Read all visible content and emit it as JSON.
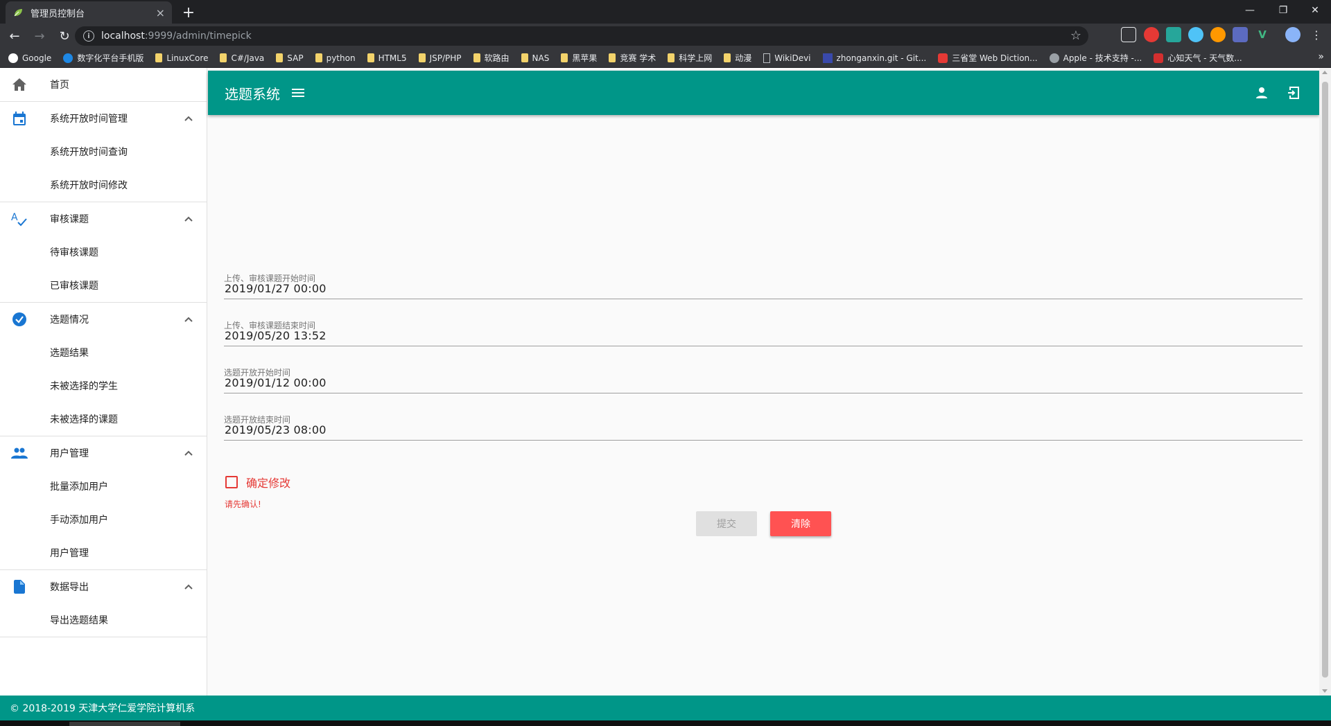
{
  "browser": {
    "tab_title": "管理员控制台",
    "url_host": "localhost",
    "url_path": ":9999/admin/timepick",
    "bookmarks": [
      {
        "label": "Google",
        "icon": "google-icon"
      },
      {
        "label": "数字化平台手机版",
        "icon": "globe-icon"
      },
      {
        "label": "LinuxCore",
        "icon": "folder-icon"
      },
      {
        "label": "C#/Java",
        "icon": "folder-icon"
      },
      {
        "label": "SAP",
        "icon": "folder-icon"
      },
      {
        "label": "python",
        "icon": "folder-icon"
      },
      {
        "label": "HTML5",
        "icon": "folder-icon"
      },
      {
        "label": "JSP/PHP",
        "icon": "folder-icon"
      },
      {
        "label": "软路由",
        "icon": "folder-icon"
      },
      {
        "label": "NAS",
        "icon": "folder-icon"
      },
      {
        "label": "黑苹果",
        "icon": "folder-icon"
      },
      {
        "label": "竞赛 学术",
        "icon": "folder-icon"
      },
      {
        "label": "科学上网",
        "icon": "folder-icon"
      },
      {
        "label": "动漫",
        "icon": "folder-icon"
      },
      {
        "label": "WikiDevi",
        "icon": "page-icon"
      },
      {
        "label": "zhonganxin.git - Git...",
        "icon": "git-icon"
      },
      {
        "label": "三省堂 Web Diction...",
        "icon": "dictionary-icon"
      },
      {
        "label": "Apple - 技术支持 -...",
        "icon": "apple-icon"
      },
      {
        "label": "心知天气 - 天气数...",
        "icon": "weather-icon"
      }
    ],
    "bookmarks_more": "»"
  },
  "appbar": {
    "brand": "选题系统"
  },
  "sidebar": {
    "home": "首页",
    "groups": [
      {
        "label": "系统开放时间管理",
        "icon": "calendar-icon",
        "items": [
          "系统开放时间查询",
          "系统开放时间修改"
        ]
      },
      {
        "label": "审核课题",
        "icon": "spellcheck-icon",
        "items": [
          "待审核课题",
          "已审核课题"
        ]
      },
      {
        "label": "选题情况",
        "icon": "check-circle-icon",
        "items": [
          "选题结果",
          "未被选择的学生",
          "未被选择的课题"
        ]
      },
      {
        "label": "用户管理",
        "icon": "people-icon",
        "items": [
          "批量添加用户",
          "手动添加用户",
          "用户管理"
        ]
      },
      {
        "label": "数据导出",
        "icon": "document-icon",
        "items": [
          "导出选题结果"
        ]
      }
    ]
  },
  "form": {
    "fields": [
      {
        "label": "上传、审核课题开始时间",
        "value": "2019/01/27 00:00"
      },
      {
        "label": "上传、审核课题结束时间",
        "value": "2019/05/20 13:52"
      },
      {
        "label": "选题开放开始时间",
        "value": "2019/01/12 00:00"
      },
      {
        "label": "选题开放结束时间",
        "value": "2019/05/23 08:00"
      }
    ],
    "confirm_label": "确定修改",
    "error_text": "请先确认!",
    "submit_label": "提交",
    "clear_label": "清除"
  },
  "footer": {
    "text": "© 2018-2019 天津大学仁爱学院计算机系"
  },
  "colors": {
    "primary": "#009688",
    "accent_red": "#ff5252",
    "error": "#e53935",
    "nav_icon_blue": "#1976d2"
  }
}
